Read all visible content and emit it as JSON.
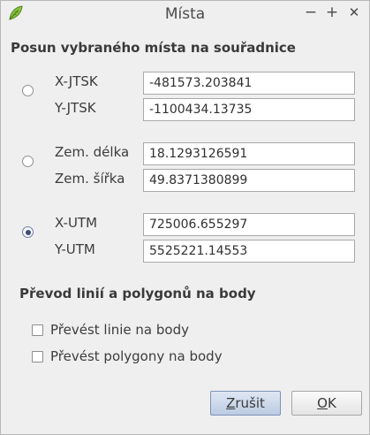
{
  "window": {
    "title": "Místa",
    "minimize": "−",
    "maximize": "+",
    "close": "✕"
  },
  "shift": {
    "heading": "Posun vybraného místa na souřadnice",
    "groups": [
      {
        "selected": false,
        "rows": [
          {
            "label": "X-JTSK",
            "value": "-481573.203841"
          },
          {
            "label": "Y-JTSK",
            "value": "-1100434.13735"
          }
        ]
      },
      {
        "selected": false,
        "rows": [
          {
            "label": "Zem. délka",
            "value": "18.1293126591"
          },
          {
            "label": "Zem. šířka",
            "value": "49.8371380899"
          }
        ]
      },
      {
        "selected": true,
        "rows": [
          {
            "label": "X-UTM",
            "value": "725006.655297"
          },
          {
            "label": "Y-UTM",
            "value": "5525221.14553"
          }
        ]
      }
    ]
  },
  "convert": {
    "heading": "Převod linií a polygonů na body",
    "options": [
      {
        "label": "Převést linie na body",
        "checked": false
      },
      {
        "label": "Převést polygony na body",
        "checked": false
      }
    ]
  },
  "buttons": {
    "cancel": {
      "mnemonic": "Z",
      "rest": "rušit"
    },
    "ok": {
      "mnemonic": "O",
      "rest": "K"
    }
  },
  "icons": {
    "app": "qgis-leaf-icon",
    "accent": "#7fb83a"
  }
}
